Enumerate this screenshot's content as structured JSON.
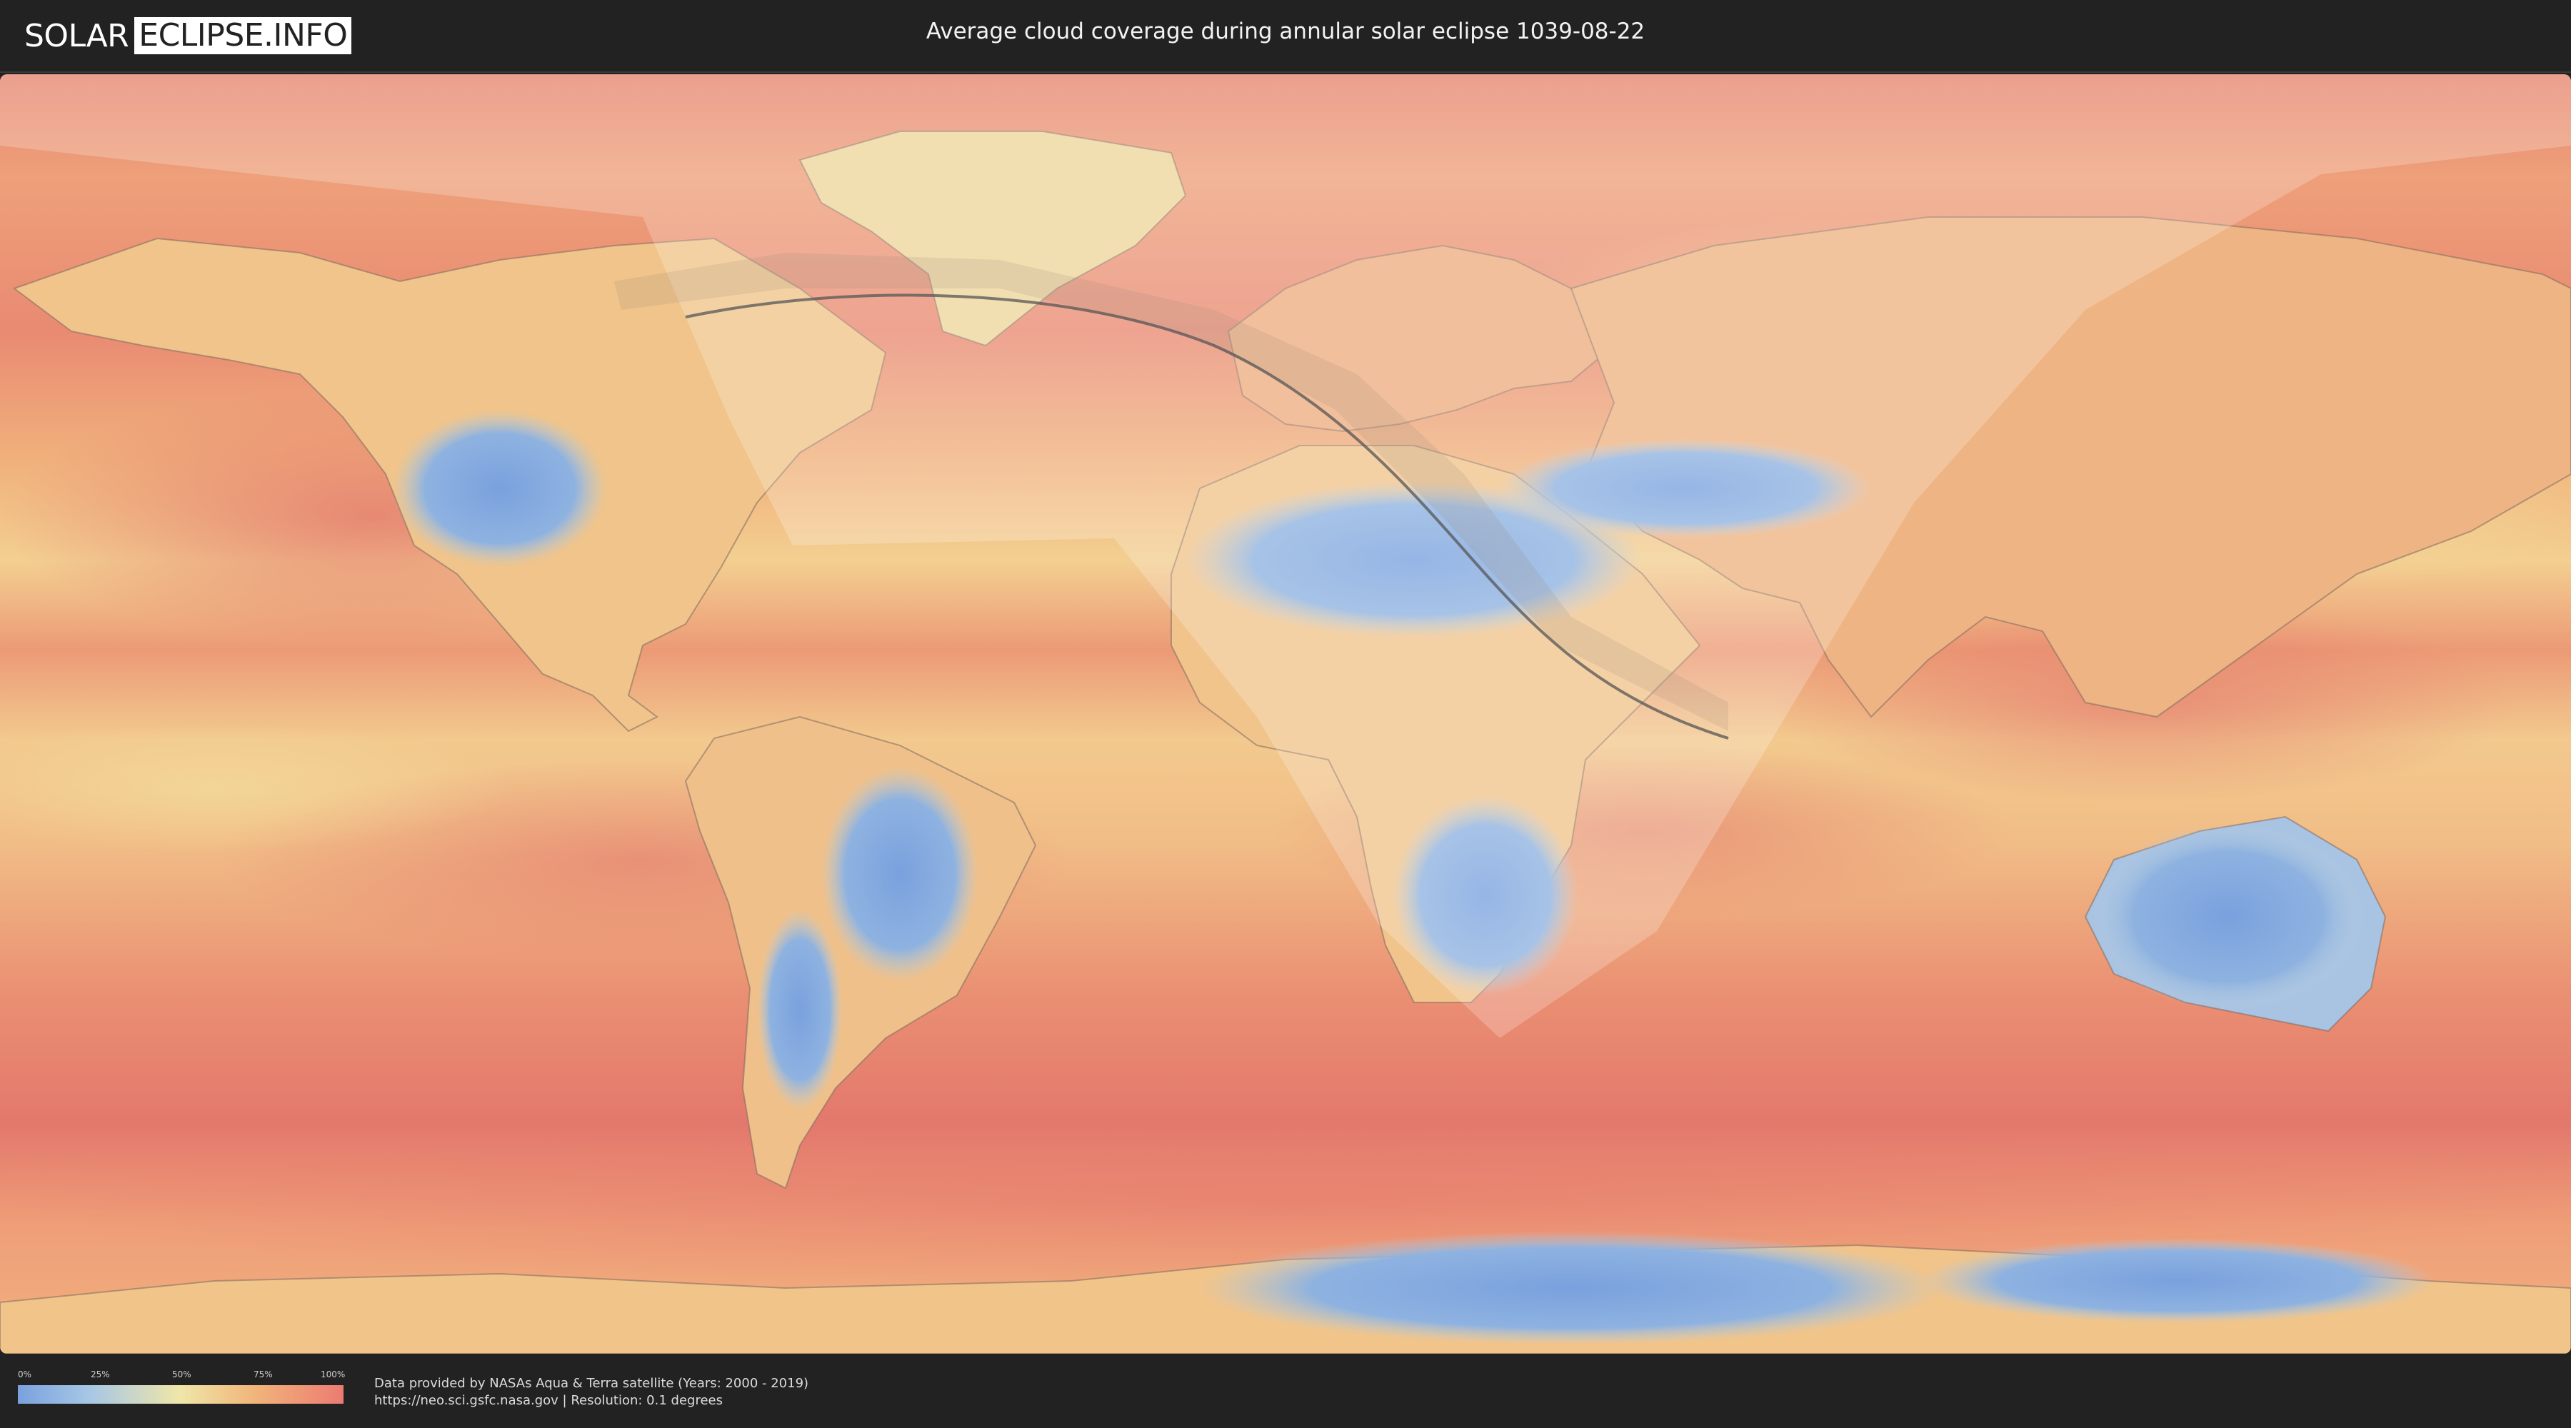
{
  "header": {
    "logo_left": "SOLAR",
    "logo_right": "ECLIPSE.INFO",
    "title": "Average cloud coverage during annular solar eclipse 1039-08-22"
  },
  "map": {
    "projection": "equirectangular world map",
    "layer": "average cloud coverage",
    "eclipse_type": "annular",
    "eclipse_date": "1039-08-22",
    "colors": {
      "low_cloud": "#7aa1de",
      "mid_cloud": "#f0e6a8",
      "high_cloud": "#ec7b72",
      "ocean_base": "#e89a78",
      "eclipse_overlay": "#ffffff",
      "central_line": "#555555"
    }
  },
  "legend": {
    "ticks": [
      "0%",
      "25%",
      "50%",
      "75%",
      "100%"
    ],
    "gradient": [
      "#7aa1de",
      "#a7c7e5",
      "#f0e6a8",
      "#f1b67b",
      "#ec7b72"
    ]
  },
  "footer": {
    "credit_line1": "Data provided by NASAs Aqua & Terra satellite (Years: 2000 - 2019)",
    "credit_line2": "https://neo.sci.gsfc.nasa.gov | Resolution: 0.1 degrees"
  }
}
